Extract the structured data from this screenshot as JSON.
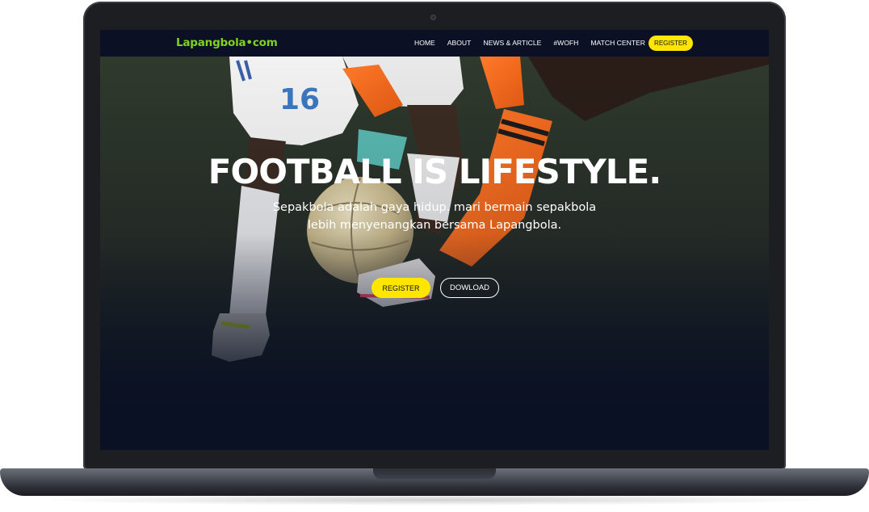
{
  "site": {
    "logo": "Lapangbola•com"
  },
  "nav": {
    "items": [
      {
        "label": "HOME"
      },
      {
        "label": "ABOUT"
      },
      {
        "label": "NEWS & ARTICLE"
      },
      {
        "label": "#WOFH"
      },
      {
        "label": "MATCH CENTER"
      }
    ],
    "register_label": "REGISTER"
  },
  "hero": {
    "title": "FOOTBALL IS LIFESTYLE.",
    "subtitle_line1": "Sepakbola adalah gaya hidup. mari bermain sepakbola",
    "subtitle_line2": "lebih menyenangkan bersama Lapangbola.",
    "register_label": "REGISTER",
    "download_label": "DOWLOAD",
    "photo": "football-players-ball-photo"
  },
  "colors": {
    "accent_yellow": "#ffe600",
    "logo_green": "#7ed321",
    "nav_bg": "#0b1024",
    "screen_bg": "#0a1124",
    "laptop_body": "#1c1e22"
  }
}
